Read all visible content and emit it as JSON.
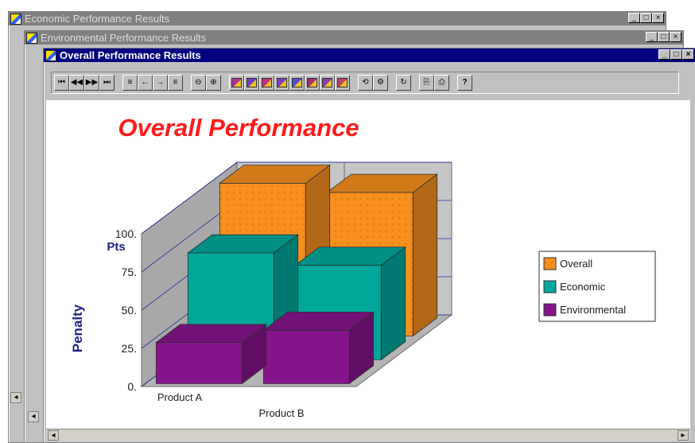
{
  "windows": {
    "economic": {
      "title": "Economic Performance Results"
    },
    "environmental": {
      "title": "Environmental Performance Results"
    },
    "overall": {
      "title": "Overall Performance Results"
    }
  },
  "window_controls": {
    "minimize": "_",
    "maximize": "□",
    "close": "×"
  },
  "toolbar": {
    "groups": [
      {
        "name": "navigation",
        "buttons": [
          "first",
          "previous",
          "next",
          "last"
        ]
      },
      {
        "name": "alignment",
        "buttons": [
          "align-left",
          "arrow-left",
          "arrow-right",
          "align-right"
        ]
      },
      {
        "name": "zoom",
        "buttons": [
          "zoom-out",
          "zoom-in"
        ]
      },
      {
        "name": "chart-types",
        "buttons": [
          "chart-3d-bar",
          "chart-ribbon",
          "chart-area",
          "chart-surface",
          "chart-bar-color",
          "chart-pie",
          "chart-doughnut",
          "chart-gallery"
        ]
      },
      {
        "name": "view",
        "buttons": [
          "rotate-3d",
          "chart-wizard"
        ]
      },
      {
        "name": "edit",
        "buttons": [
          "refresh"
        ]
      },
      {
        "name": "output",
        "buttons": [
          "copy",
          "print"
        ]
      },
      {
        "name": "help",
        "buttons": [
          "help"
        ]
      }
    ]
  },
  "colors": {
    "title": "#ff1a1a",
    "axis_label": "#20208a",
    "overall": "#f7901e",
    "economic": "#00a89c",
    "environmental": "#86158c"
  },
  "chart_data": {
    "type": "bar",
    "title": "Overall Performance",
    "ylabel": "Penalty",
    "yunit": "Pts",
    "ylim": [
      0,
      100
    ],
    "yticks": [
      "100.",
      "75.",
      "50.",
      "25.",
      "0."
    ],
    "categories": [
      "Product A",
      "Product B"
    ],
    "series": [
      {
        "name": "Overall",
        "values": [
          100,
          94
        ]
      },
      {
        "name": "Economic",
        "values": [
          70,
          62
        ]
      },
      {
        "name": "Environmental",
        "values": [
          27,
          35
        ]
      }
    ],
    "legend_position": "right",
    "three_d": true
  }
}
